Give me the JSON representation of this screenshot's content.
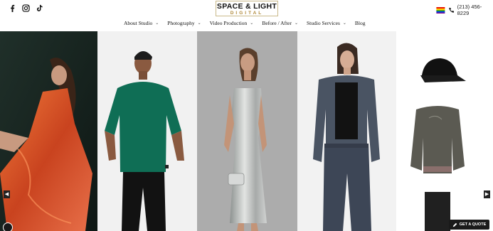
{
  "brand": {
    "logo_line1": "SPACE & LIGHT",
    "logo_line2": "DIGITAL"
  },
  "social": [
    "facebook-icon",
    "instagram-icon",
    "tiktok-icon"
  ],
  "contact": {
    "phone": "(213) 456-8229"
  },
  "nav": {
    "items": [
      {
        "label": "About Studio",
        "dropdown": true
      },
      {
        "label": "Photography",
        "dropdown": true
      },
      {
        "label": "Video Production",
        "dropdown": true
      },
      {
        "label": "Before / After",
        "dropdown": true
      },
      {
        "label": "Studio Services",
        "dropdown": true
      },
      {
        "label": "Blog",
        "dropdown": false
      }
    ]
  },
  "gallery": {
    "slides": [
      {
        "subject": "model-orange-satin-dress"
      },
      {
        "subject": "model-green-tshirt"
      },
      {
        "subject": "model-silver-slip-dress"
      },
      {
        "subject": "model-denim-outfit"
      },
      {
        "subject": "flatlay-cap-jacket-jeans"
      }
    ]
  },
  "cta": {
    "quote_label": "GET A QUOTE"
  },
  "colors": {
    "gold": "#b08a3a",
    "dark": "#1a1a1a",
    "orange_dress": "#d2532a",
    "green_tee": "#0f6e55",
    "silver": "#b9bcbb",
    "denim": "#4a5463"
  }
}
